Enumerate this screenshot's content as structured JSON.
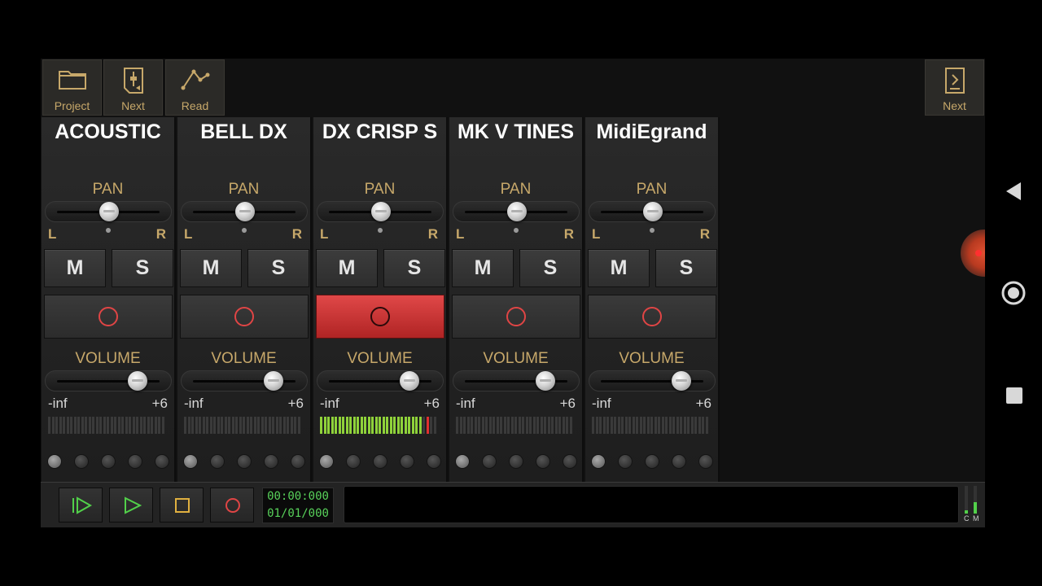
{
  "toolbar": {
    "project_label": "Project",
    "next_label": "Next",
    "read_label": "Read",
    "next_right_label": "Next"
  },
  "channels": [
    {
      "name": "ACOUSTIC",
      "pan_label": "PAN",
      "left_label": "L",
      "right_label": "R",
      "mute_label": "M",
      "solo_label": "S",
      "record_armed": false,
      "volume_label": "VOLUME",
      "vol_min": "-inf",
      "vol_max": "+6",
      "meter_level": 0
    },
    {
      "name": "BELL DX",
      "pan_label": "PAN",
      "left_label": "L",
      "right_label": "R",
      "mute_label": "M",
      "solo_label": "S",
      "record_armed": false,
      "volume_label": "VOLUME",
      "vol_min": "-inf",
      "vol_max": "+6",
      "meter_level": 0
    },
    {
      "name": "DX CRISP S",
      "pan_label": "PAN",
      "left_label": "L",
      "right_label": "R",
      "mute_label": "M",
      "solo_label": "S",
      "record_armed": true,
      "volume_label": "VOLUME",
      "vol_min": "-inf",
      "vol_max": "+6",
      "meter_level": 0.93
    },
    {
      "name": "MK V TINES",
      "pan_label": "PAN",
      "left_label": "L",
      "right_label": "R",
      "mute_label": "M",
      "solo_label": "S",
      "record_armed": false,
      "volume_label": "VOLUME",
      "vol_min": "-inf",
      "vol_max": "+6",
      "meter_level": 0
    },
    {
      "name": "MidiEgrand",
      "pan_label": "PAN",
      "left_label": "L",
      "right_label": "R",
      "mute_label": "M",
      "solo_label": "S",
      "record_armed": false,
      "volume_label": "VOLUME",
      "vol_min": "-inf",
      "vol_max": "+6",
      "meter_level": 0
    }
  ],
  "pan_value": 0.5,
  "volume_value": 0.78,
  "transport": {
    "time": "00:00:000",
    "date": "01/01/000",
    "meter_c_label": "C",
    "meter_m_label": "M"
  },
  "colors": {
    "accent_gold": "#c7a86a",
    "record_red": "#e04545",
    "meter_green": "#8fd23a",
    "time_green": "#58d25a"
  }
}
